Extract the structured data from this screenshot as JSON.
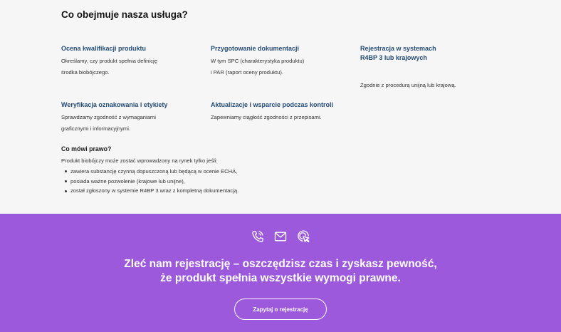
{
  "section": {
    "heading": "Co obejmuje nasza usługa?"
  },
  "features": [
    {
      "title": "Ocena kwalifikacji produktu",
      "lines": [
        "Określamy, czy produkt spełnia definicję",
        "środka biobójczego."
      ]
    },
    {
      "title": "Przygotowanie dokumentacji",
      "lines": [
        "W tym SPC (charakterystyka produktu)",
        "i PAR (raport oceny produktu)."
      ]
    },
    {
      "title_lines": [
        "Rejestracja w systemach",
        "R4BP 3 lub krajowych"
      ],
      "lines": [
        "Zgodnie z procedurą unijną lub krajową."
      ]
    },
    {
      "title": "Weryfikacja oznakowania i etykiety",
      "lines": [
        "Sprawdzamy zgodność z wymaganiami",
        "graficznymi i informacyjnymi."
      ]
    },
    {
      "title": "Aktualizacje i wsparcie podczas kontroli",
      "lines": [
        "Zapewniamy ciągłość zgodności z przepisami."
      ]
    }
  ],
  "law": {
    "title": "Co mówi prawo?",
    "intro": "Produkt biobójczy może zostać wprowadzony na rynek tylko jeśli:",
    "items": [
      "zawiera substancję czynną dopuszczoną lub będącą w ocenie ECHA,",
      "posiada ważne pozwolenie (krajowe lub unijne),",
      "został zgłoszony w systemie R4BP 3 wraz z kompletną dokumentacją."
    ]
  },
  "cta": {
    "icons": [
      "phone-icon",
      "mail-icon",
      "click-cursor-icon"
    ],
    "line1": "Zleć nam rejestrację – oszczędzisz czas i zyskasz pewność,",
    "line2": "że produkt spełnia wszystkie wymogi prawne.",
    "button_label": "Zapytaj o rejestrację",
    "background": "#9c59dc",
    "text_color": "#ffffff"
  },
  "colors": {
    "feature_title": "#244c76",
    "page_background": "#f6f6f6"
  }
}
